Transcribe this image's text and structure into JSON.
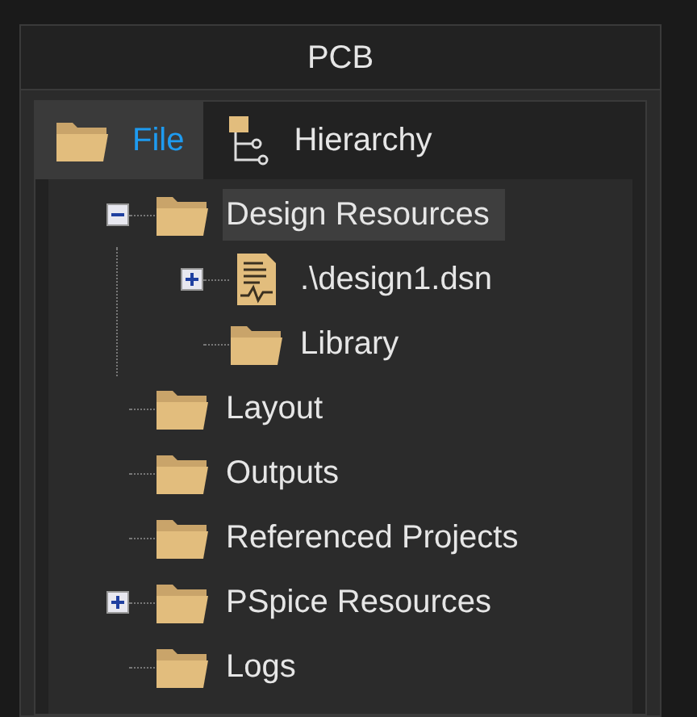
{
  "panel": {
    "title": "PCB"
  },
  "tabs": [
    {
      "label": "File",
      "kind": "folder",
      "selected": true
    },
    {
      "label": "Hierarchy",
      "kind": "hierarchy",
      "selected": false
    }
  ],
  "tree": [
    {
      "label": "Design Resources",
      "kind": "folder",
      "expanded": true,
      "selected": true,
      "children": [
        {
          "label": ".\\design1.dsn",
          "kind": "file",
          "expanded": false,
          "selected": false
        },
        {
          "label": "Library",
          "kind": "folder",
          "selected": false
        }
      ]
    },
    {
      "label": "Layout",
      "kind": "folder",
      "selected": false
    },
    {
      "label": "Outputs",
      "kind": "folder",
      "selected": false
    },
    {
      "label": "Referenced Projects",
      "kind": "folder",
      "selected": false
    },
    {
      "label": "PSpice Resources",
      "kind": "folder",
      "expanded": false,
      "selected": false
    },
    {
      "label": "Logs",
      "kind": "folder",
      "selected": false
    }
  ]
}
